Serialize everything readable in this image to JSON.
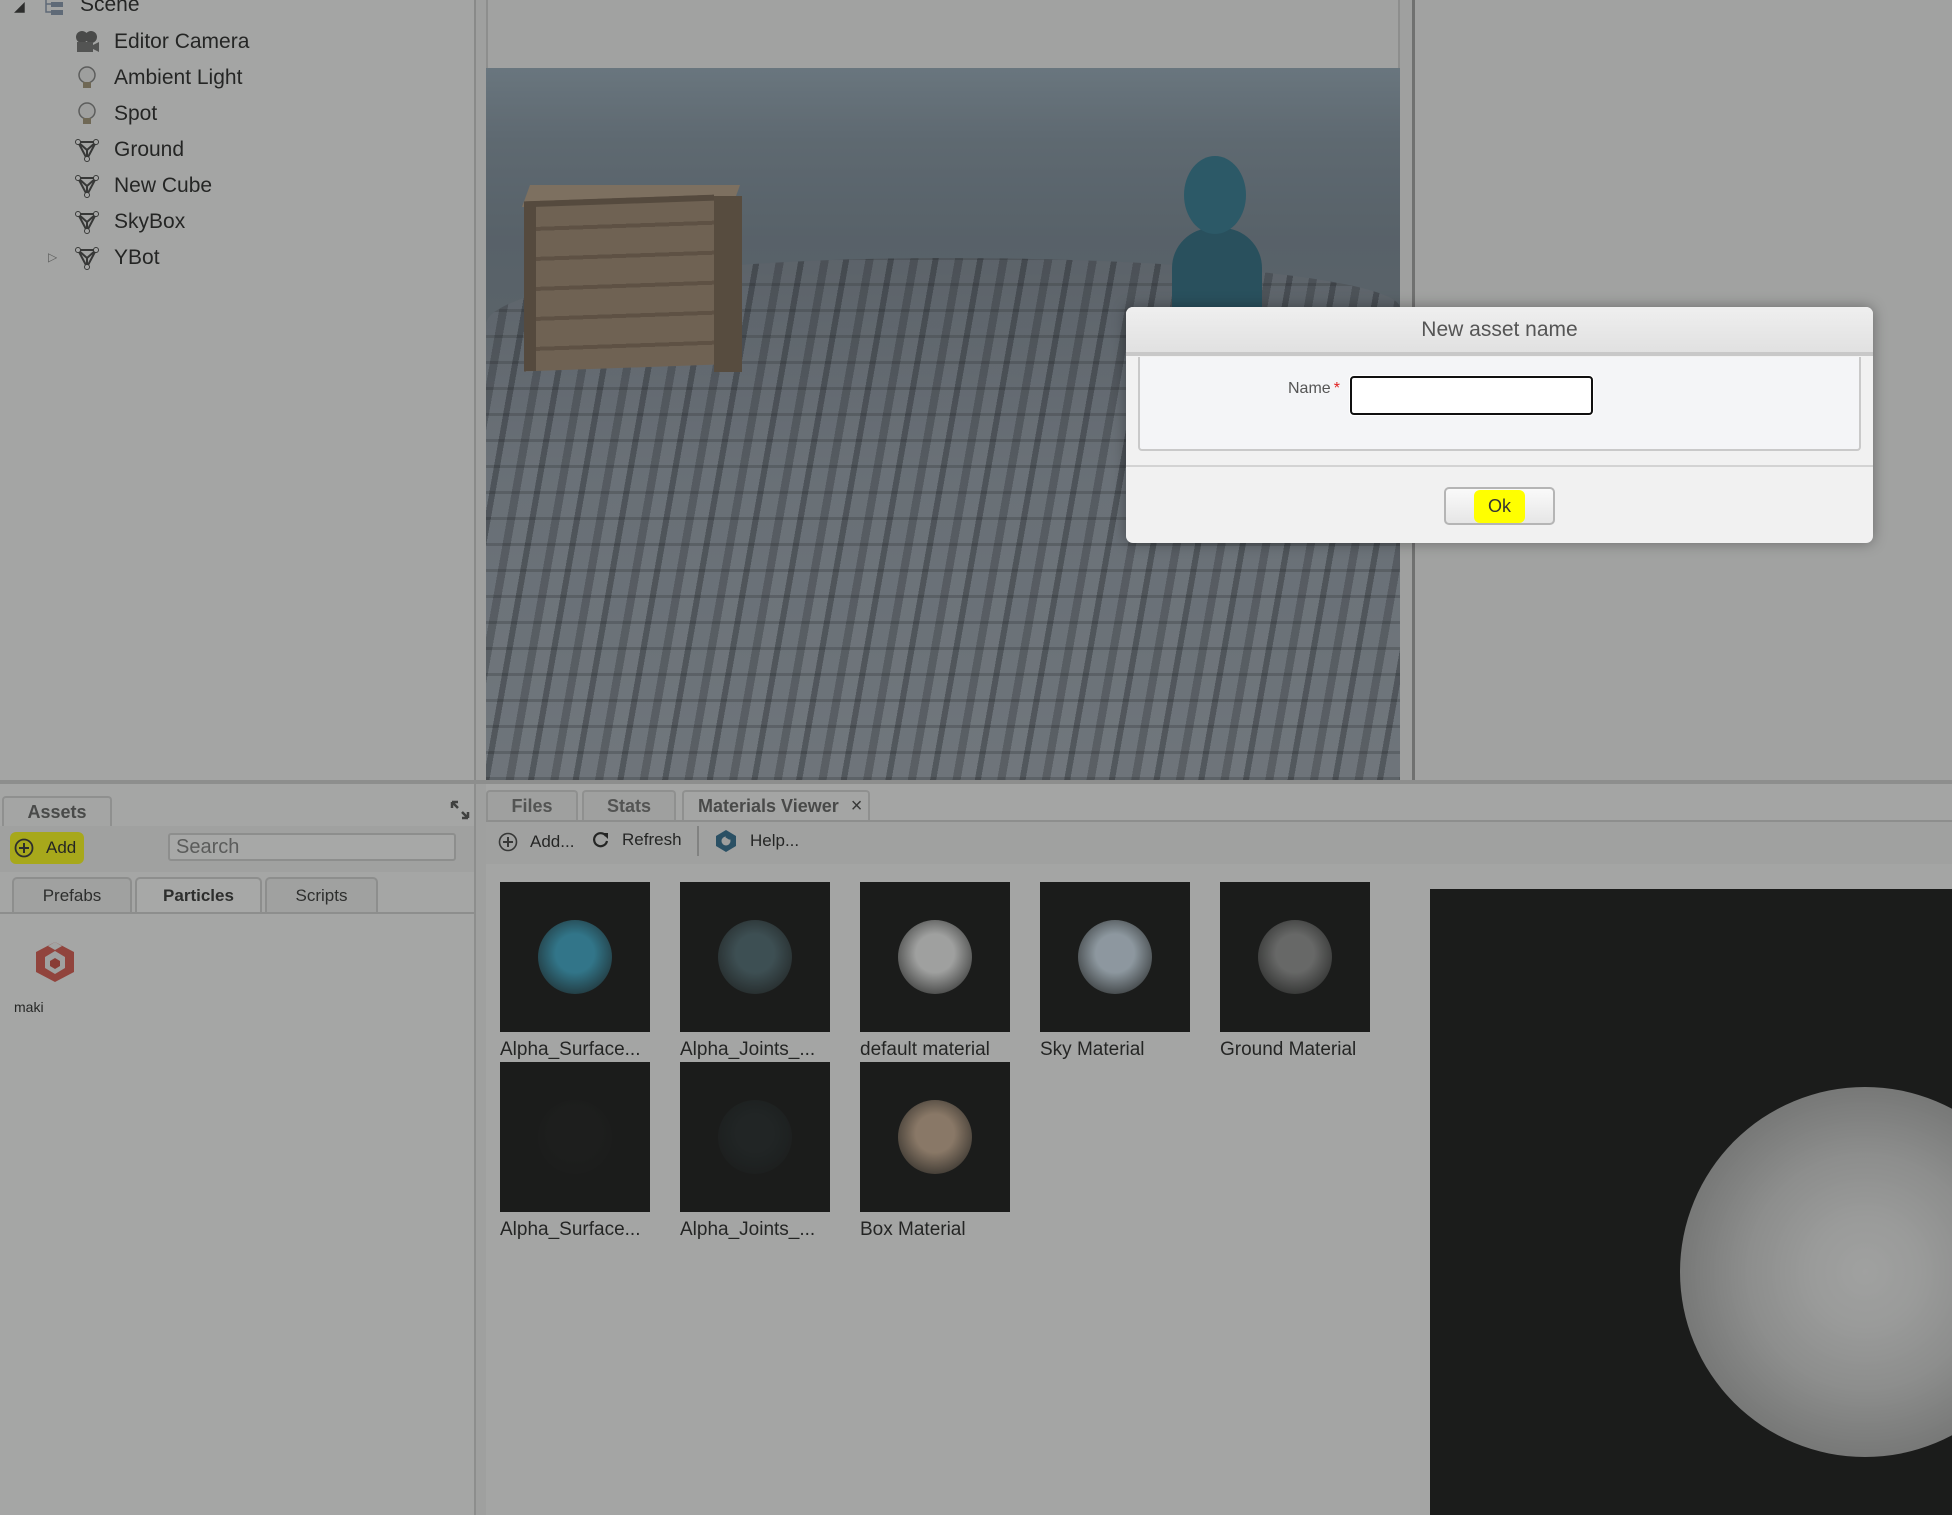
{
  "scene_tree": {
    "root": {
      "label": "Scene",
      "icon": "scene-hierarchy-icon",
      "expanded": true
    },
    "items": [
      {
        "label": "Editor Camera",
        "icon": "camera-icon"
      },
      {
        "label": "Ambient Light",
        "icon": "light-bulb-icon"
      },
      {
        "label": "Spot",
        "icon": "light-bulb-icon"
      },
      {
        "label": "Ground",
        "icon": "mesh-icon"
      },
      {
        "label": "New Cube",
        "icon": "mesh-icon"
      },
      {
        "label": "SkyBox",
        "icon": "mesh-icon"
      },
      {
        "label": "YBot",
        "icon": "mesh-icon",
        "expandable": true
      }
    ]
  },
  "assets_panel": {
    "tab_label": "Assets",
    "add_label": "Add",
    "search_placeholder": "Search",
    "sub_tabs": [
      {
        "label": "Prefabs",
        "active": false
      },
      {
        "label": "Particles",
        "active": true
      },
      {
        "label": "Scripts",
        "active": false
      }
    ],
    "items": [
      {
        "label": "maki",
        "icon": "particle-system-icon"
      }
    ]
  },
  "bottom_panel": {
    "tabs": [
      {
        "label": "Files",
        "active": false
      },
      {
        "label": "Stats",
        "active": false
      },
      {
        "label": "Materials Viewer",
        "active": true,
        "closable": true
      }
    ],
    "toolbar": {
      "add_label": "Add...",
      "refresh_label": "Refresh",
      "help_label": "Help..."
    },
    "materials": [
      {
        "label": "Alpha_Surface...",
        "color": "#2aa3c8"
      },
      {
        "label": "Alpha_Joints_...",
        "color": "#3f5d66"
      },
      {
        "label": "default material",
        "color": "#f0f0f0"
      },
      {
        "label": "Sky Material",
        "color": "#cfe1f0"
      },
      {
        "label": "Ground Material",
        "color": "#8a8a8a"
      },
      {
        "label": "Alpha_Surface...",
        "color": "#050505"
      },
      {
        "label": "Alpha_Joints_...",
        "color": "#0b1113"
      },
      {
        "label": "Box Material",
        "color": "#c9a88a"
      }
    ]
  },
  "dialog": {
    "title": "New asset name",
    "name_label": "Name",
    "required_mark": "*",
    "name_value": "",
    "ok_label": "Ok"
  },
  "colors": {
    "highlight": "#ffff00",
    "required": "#e02020",
    "input_focus_border": "#8db8ee"
  }
}
